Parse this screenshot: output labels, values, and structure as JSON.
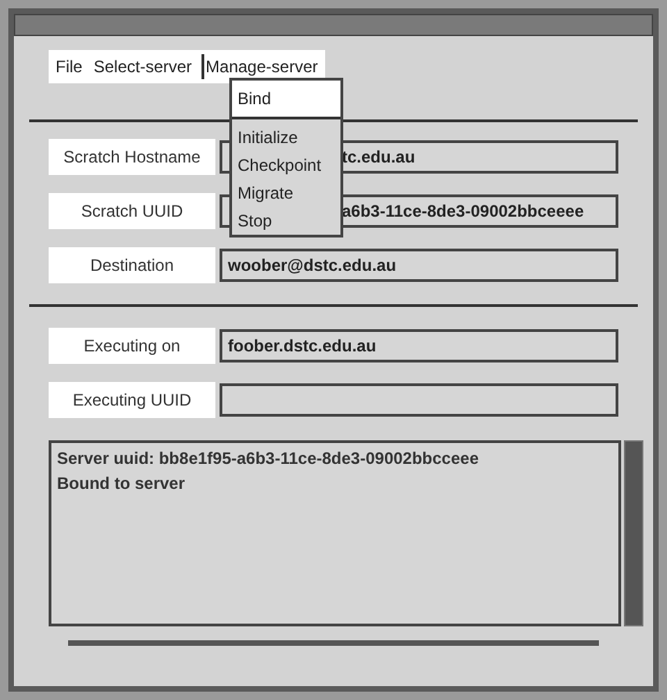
{
  "menubar": [
    {
      "label": "File",
      "selected": false
    },
    {
      "label": "Select-server",
      "selected": false
    },
    {
      "label": "Manage-server",
      "selected": true
    }
  ],
  "menu": {
    "items": [
      {
        "label": "Bind",
        "selected": true
      },
      {
        "label": "Initialize",
        "selected": false
      },
      {
        "label": "Checkpoint",
        "selected": false
      },
      {
        "label": "Migrate",
        "selected": false
      },
      {
        "label": "Stop",
        "selected": false
      }
    ]
  },
  "groups": [
    [
      {
        "label": "Scratch Hostname",
        "value": "tc.edu.au",
        "covered": true
      },
      {
        "label": "Scratch UUID",
        "value": "a6b3-11ce-8de3-09002bbceeee",
        "covered": true
      },
      {
        "label": "Destination",
        "value": "woober@dstc.edu.au"
      }
    ],
    [
      {
        "label": "Executing on",
        "value": "foober.dstc.edu.au"
      },
      {
        "label": "Executing UUID"
      }
    ]
  ],
  "log": {
    "lines": [
      "Server uuid: bb8e1f95-a6b3-11ce-8de3-09002bbcceee",
      "Bound to server"
    ]
  }
}
